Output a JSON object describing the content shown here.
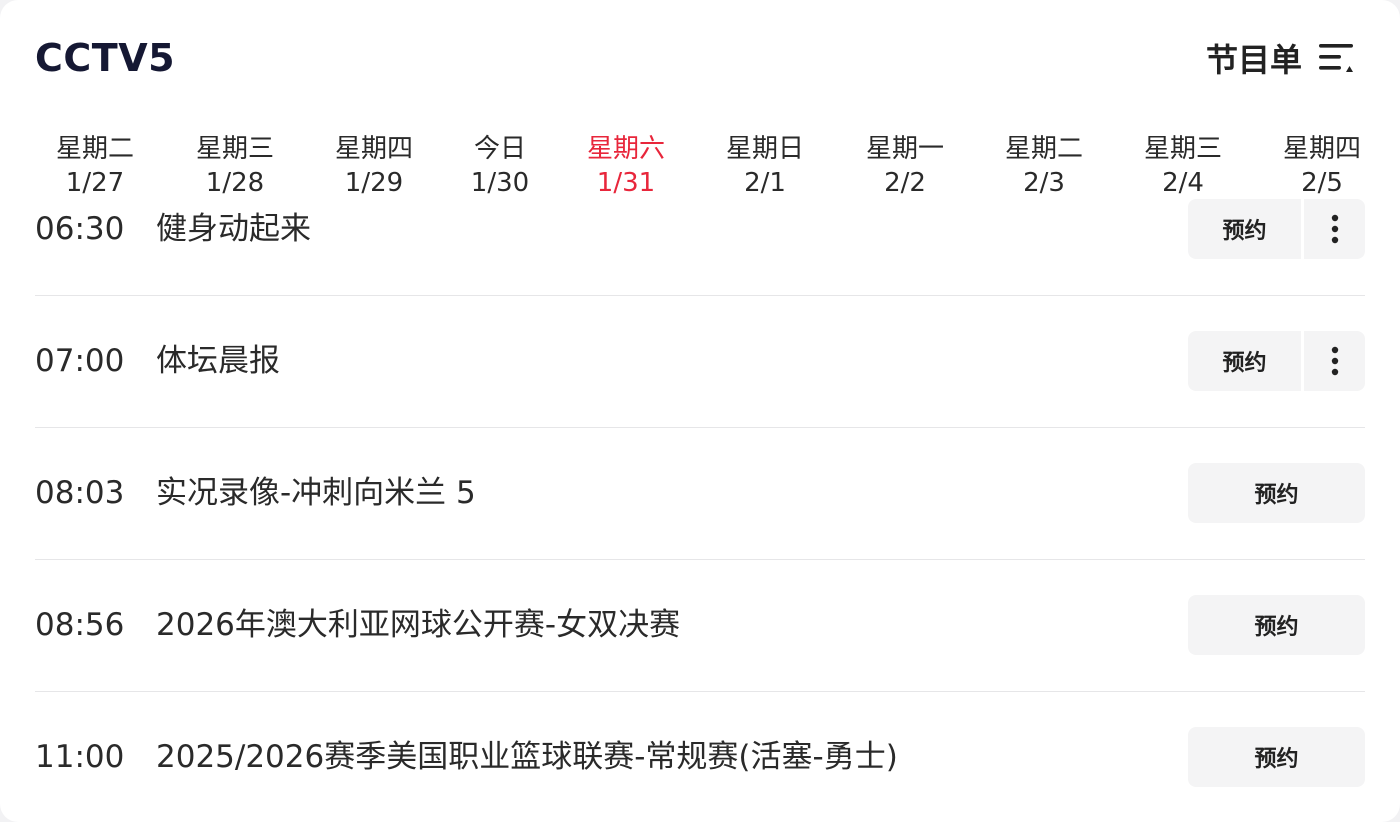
{
  "header": {
    "channel": "CCTV5",
    "schedule_label": "节目单"
  },
  "date_tabs": [
    {
      "dow": "星期二",
      "date": "1/27",
      "active": false
    },
    {
      "dow": "星期三",
      "date": "1/28",
      "active": false
    },
    {
      "dow": "星期四",
      "date": "1/29",
      "active": false
    },
    {
      "dow": "今日",
      "date": "1/30",
      "active": false
    },
    {
      "dow": "星期六",
      "date": "1/31",
      "active": true
    },
    {
      "dow": "星期日",
      "date": "2/1",
      "active": false
    },
    {
      "dow": "星期一",
      "date": "2/2",
      "active": false
    },
    {
      "dow": "星期二",
      "date": "2/3",
      "active": false
    },
    {
      "dow": "星期三",
      "date": "2/4",
      "active": false
    },
    {
      "dow": "星期四",
      "date": "2/5",
      "active": false
    }
  ],
  "programs": [
    {
      "time": "06:30",
      "title": "健身动起来",
      "action": "预约",
      "has_more": true
    },
    {
      "time": "07:00",
      "title": "体坛晨报",
      "action": "预约",
      "has_more": true
    },
    {
      "time": "08:03",
      "title": "实况录像-冲刺向米兰 5",
      "action": "预约",
      "has_more": false
    },
    {
      "time": "08:56",
      "title": "2026年澳大利亚网球公开赛-女双决赛",
      "action": "预约",
      "has_more": false
    },
    {
      "time": "11:00",
      "title": "2025/2026赛季美国职业篮球联赛-常规赛(活塞-勇士)",
      "action": "预约",
      "has_more": false
    }
  ],
  "colors": {
    "active_tab": "#e8263b",
    "title": "#151833",
    "button_bg": "#f4f4f5",
    "divider": "#e6e6e8"
  },
  "icons": {
    "schedule": "list-sort-icon",
    "more": "more-vertical-icon"
  }
}
